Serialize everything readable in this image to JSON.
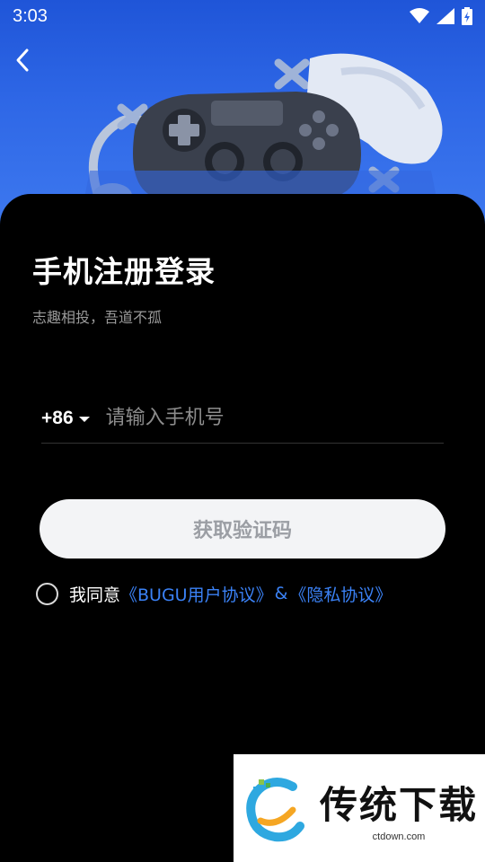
{
  "status_bar": {
    "time": "3:03"
  },
  "header": {
    "back_icon": "chevron-left-icon"
  },
  "login": {
    "title": "手机注册登录",
    "subtitle": "志趣相投，吾道不孤",
    "country_code": "+86",
    "phone_placeholder": "请输入手机号",
    "get_code_button": "获取验证码"
  },
  "agreement": {
    "prefix": "我同意",
    "user_agreement": "《BUGU用户协议》",
    "amp": "&",
    "privacy_policy": "《隐私协议》"
  },
  "watermark": {
    "title": "传统下载",
    "domain": "ctdown.com"
  },
  "colors": {
    "hero_blue": "#2e67e6",
    "link_blue": "#3b82f6",
    "button_bg": "#f3f4f6",
    "button_text": "#9b9ea4"
  }
}
